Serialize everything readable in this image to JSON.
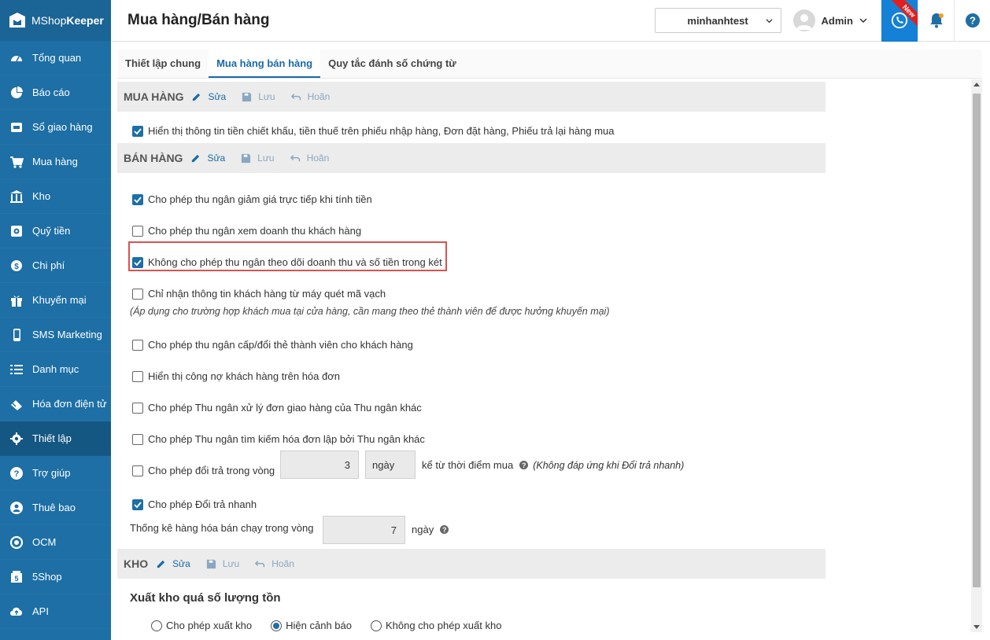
{
  "app": {
    "logo_prefix": "MShop",
    "logo_suffix": "Keeper"
  },
  "sidebar": {
    "items": [
      {
        "label": "Tổng quan",
        "icon": "dashboard-icon"
      },
      {
        "label": "Báo cáo",
        "icon": "pie-chart-icon"
      },
      {
        "label": "Sổ giao hàng",
        "icon": "delivery-icon"
      },
      {
        "label": "Mua hàng",
        "icon": "cart-icon"
      },
      {
        "label": "Kho",
        "icon": "warehouse-icon"
      },
      {
        "label": "Quỹ tiền",
        "icon": "safe-icon"
      },
      {
        "label": "Chi phí",
        "icon": "expense-icon"
      },
      {
        "label": "Khuyến mại",
        "icon": "gift-icon"
      },
      {
        "label": "SMS Marketing",
        "icon": "phone-icon"
      },
      {
        "label": "Danh mục",
        "icon": "list-icon"
      },
      {
        "label": "Hóa đơn điện tử",
        "icon": "e-invoice-icon"
      },
      {
        "label": "Thiết lập",
        "icon": "gear-icon"
      },
      {
        "label": "Trợ giúp",
        "icon": "help-icon"
      },
      {
        "label": "Thuê bao",
        "icon": "subscription-icon"
      },
      {
        "label": "OCM",
        "icon": "ocm-icon"
      },
      {
        "label": "5Shop",
        "icon": "shop-icon"
      },
      {
        "label": "API",
        "icon": "cloud-upload-icon"
      }
    ],
    "active_index": 11
  },
  "header": {
    "title": "Mua hàng/Bán hàng",
    "store": "minhanhtest",
    "user": "Admin",
    "new_badge": "New"
  },
  "tabs": [
    {
      "label": "Thiết lập chung"
    },
    {
      "label": "Mua hàng bán hàng"
    },
    {
      "label": "Quy tắc đánh số chứng từ"
    }
  ],
  "active_tab": 1,
  "actions": {
    "edit": "Sửa",
    "save": "Lưu",
    "undo": "Hoãn"
  },
  "purchase": {
    "title": "MUA HÀNG",
    "options": [
      {
        "label": "Hiển thị thông tin tiền chiết khấu, tiền thuế trên phiếu nhập hàng, Đơn đặt hàng, Phiếu trả lại hàng mua",
        "checked": true
      }
    ]
  },
  "sales": {
    "title": "BÁN HÀNG",
    "options": [
      {
        "label": "Cho phép thu ngân giảm giá trực tiếp khi tính tiền",
        "checked": true
      },
      {
        "label": "Cho phép thu ngân xem doanh thu khách hàng",
        "checked": false
      },
      {
        "label": "Không cho phép thu ngân theo dõi doanh thu và số tiền trong két",
        "checked": true
      },
      {
        "label": "Chỉ nhận thông tin khách hàng từ máy quét mã vạch",
        "checked": false
      },
      {
        "label": "Cho phép thu ngân cấp/đổi thẻ thành viên cho khách hàng",
        "checked": false
      },
      {
        "label": "Hiển thị công nợ khách hàng trên hóa đơn",
        "checked": false
      },
      {
        "label": "Cho phép Thu ngân xử lý đơn giao hàng của Thu ngân khác",
        "checked": false
      },
      {
        "label": "Cho phép Thu ngân tìm kiếm hóa đơn lập bởi Thu ngân khác",
        "checked": false
      },
      {
        "label": "Cho phép đổi trả trong vòng",
        "checked": false
      },
      {
        "label": "Cho phép Đổi trả nhanh",
        "checked": true
      }
    ],
    "barcode_note": "(Áp dụng cho trường hợp khách mua tại cửa hàng, cần mang theo thẻ thành viên để được hưởng khuyến mại)",
    "return_days": "3",
    "return_unit": "ngày",
    "return_suffix": "kể từ thời điểm mua",
    "return_note": "(Không đáp ứng khi Đổi trả nhanh)",
    "bestseller_label": "Thống kê hàng hóa bán chạy trong vòng",
    "bestseller_days": "7",
    "bestseller_unit": "ngày"
  },
  "stock": {
    "title": "KHO",
    "overstock_label": "Xuất kho quá số lượng tồn",
    "radios": [
      {
        "label": "Cho phép xuất kho",
        "selected": false
      },
      {
        "label": "Hiện cảnh báo",
        "selected": true
      },
      {
        "label": "Không cho phép xuất kho",
        "selected": false
      }
    ]
  },
  "colors": {
    "sidebar": "#1d6fa5",
    "accent": "#1a6aa8",
    "highlight": "#d9534f"
  }
}
